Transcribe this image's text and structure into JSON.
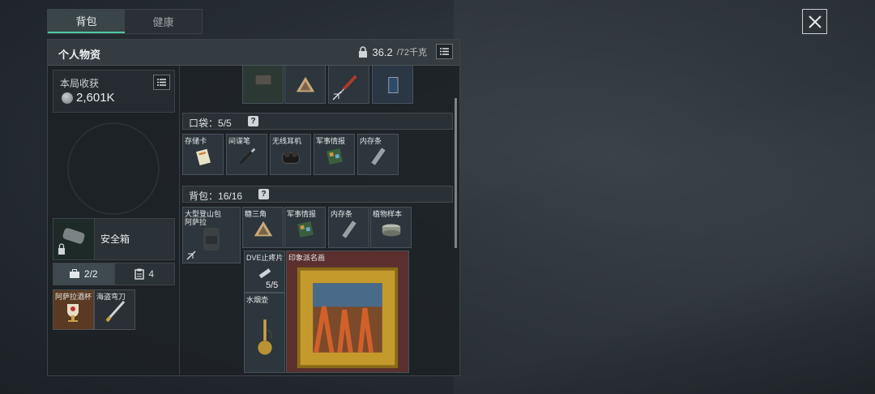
{
  "tabs": [
    {
      "label": "背包"
    },
    {
      "label": "健康"
    }
  ],
  "header": {
    "title": "个人物资",
    "weight_current": "36.2",
    "weight_max": "/72千克"
  },
  "harvest": {
    "label": "本局收获",
    "value": "2,601K"
  },
  "safe_box": {
    "label": "安全箱"
  },
  "slot_tabs": [
    {
      "value": "2/2"
    },
    {
      "value": "4"
    }
  ],
  "mini_items": [
    {
      "label": "阿萨拉酒杯"
    },
    {
      "label": "海盗弯刀"
    }
  ],
  "pocket": {
    "label": "口袋：",
    "count": "5/5",
    "help": "?"
  },
  "pocket_items": [
    {
      "label": "存储卡"
    },
    {
      "label": "间谍笔"
    },
    {
      "label": "无线耳机"
    },
    {
      "label": "军事情报"
    },
    {
      "label": "内存条"
    }
  ],
  "backpack": {
    "label": "背包：",
    "count": "16/16",
    "help": "?"
  },
  "backpack_items": [
    {
      "label": "大型登山包"
    },
    {
      "label": "阿萨拉"
    },
    {
      "label": "糖三角"
    },
    {
      "label": "军事情报"
    },
    {
      "label": "内存条"
    },
    {
      "label": "植物样本"
    }
  ],
  "inner_items": [
    {
      "label": "DVE止疼片",
      "count": "5/5"
    },
    {
      "label": "印象派名画"
    },
    {
      "label": "水烟壶"
    }
  ],
  "colors": {
    "accent": "#4ec9a0",
    "gold_bg": "#5a2f2e",
    "panel": "#1c2126"
  }
}
